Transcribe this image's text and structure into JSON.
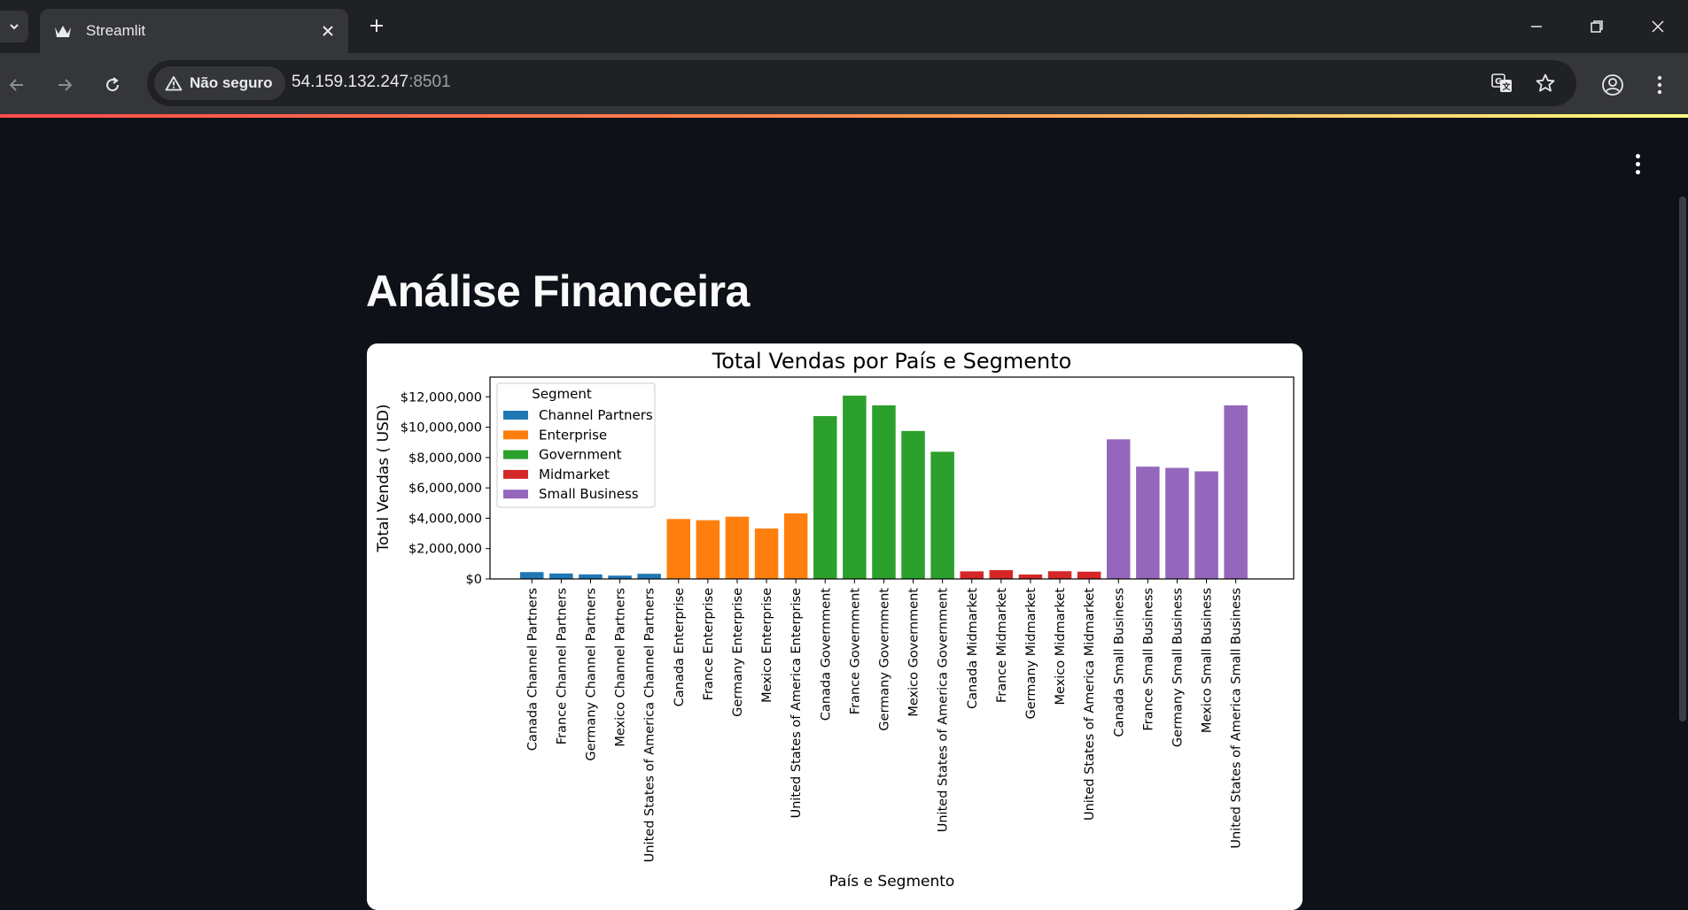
{
  "browser": {
    "tab_title": "Streamlit",
    "security_label": "Não seguro",
    "url_host": "54.159.132.247",
    "url_port": ":8501"
  },
  "app": {
    "title": "Análise Financeira"
  },
  "chart_data": {
    "type": "bar",
    "title": "Total Vendas por País e Segmento",
    "xlabel": "País e Segmento",
    "ylabel": "Total Vendas ( USD)",
    "ylim": [
      0,
      13300000
    ],
    "yticks": [
      0,
      2000000,
      4000000,
      6000000,
      8000000,
      10000000,
      12000000
    ],
    "ytick_labels": [
      "$0",
      "$2,000,000",
      "$4,000,000",
      "$6,000,000",
      "$8,000,000",
      "$10,000,000",
      "$12,000,000"
    ],
    "grid": false,
    "legend": {
      "title": "Segment",
      "placement": "top-left",
      "entries": [
        {
          "name": "Channel Partners",
          "color": "#1f77b4"
        },
        {
          "name": "Enterprise",
          "color": "#ff7f0e"
        },
        {
          "name": "Government",
          "color": "#2ca02c"
        },
        {
          "name": "Midmarket",
          "color": "#d62728"
        },
        {
          "name": "Small Business",
          "color": "#9467bd"
        }
      ]
    },
    "categories": [
      "Canada Channel Partners",
      "France Channel Partners",
      "Germany Channel Partners",
      "Mexico Channel Partners",
      "United States of America Channel Partners",
      "Canada Enterprise",
      "France Enterprise",
      "Germany Enterprise",
      "Mexico Enterprise",
      "United States of America Enterprise",
      "Canada Government",
      "France Government",
      "Germany Government",
      "Mexico Government",
      "United States of America Government",
      "Canada Midmarket",
      "France Midmarket",
      "Germany Midmarket",
      "Mexico Midmarket",
      "United States of America Midmarket",
      "Canada Small Business",
      "France Small Business",
      "Germany Small Business",
      "Mexico Small Business",
      "United States of America Small Business"
    ],
    "segments": [
      "Channel Partners",
      "Channel Partners",
      "Channel Partners",
      "Channel Partners",
      "Channel Partners",
      "Enterprise",
      "Enterprise",
      "Enterprise",
      "Enterprise",
      "Enterprise",
      "Government",
      "Government",
      "Government",
      "Government",
      "Government",
      "Midmarket",
      "Midmarket",
      "Midmarket",
      "Midmarket",
      "Midmarket",
      "Small Business",
      "Small Business",
      "Small Business",
      "Small Business",
      "Small Business"
    ],
    "values": [
      450000,
      360000,
      300000,
      220000,
      340000,
      3950000,
      3870000,
      4100000,
      3320000,
      4320000,
      10730000,
      12080000,
      11440000,
      9750000,
      8380000,
      500000,
      580000,
      290000,
      510000,
      480000,
      9200000,
      7400000,
      7320000,
      7090000,
      11440000
    ]
  }
}
